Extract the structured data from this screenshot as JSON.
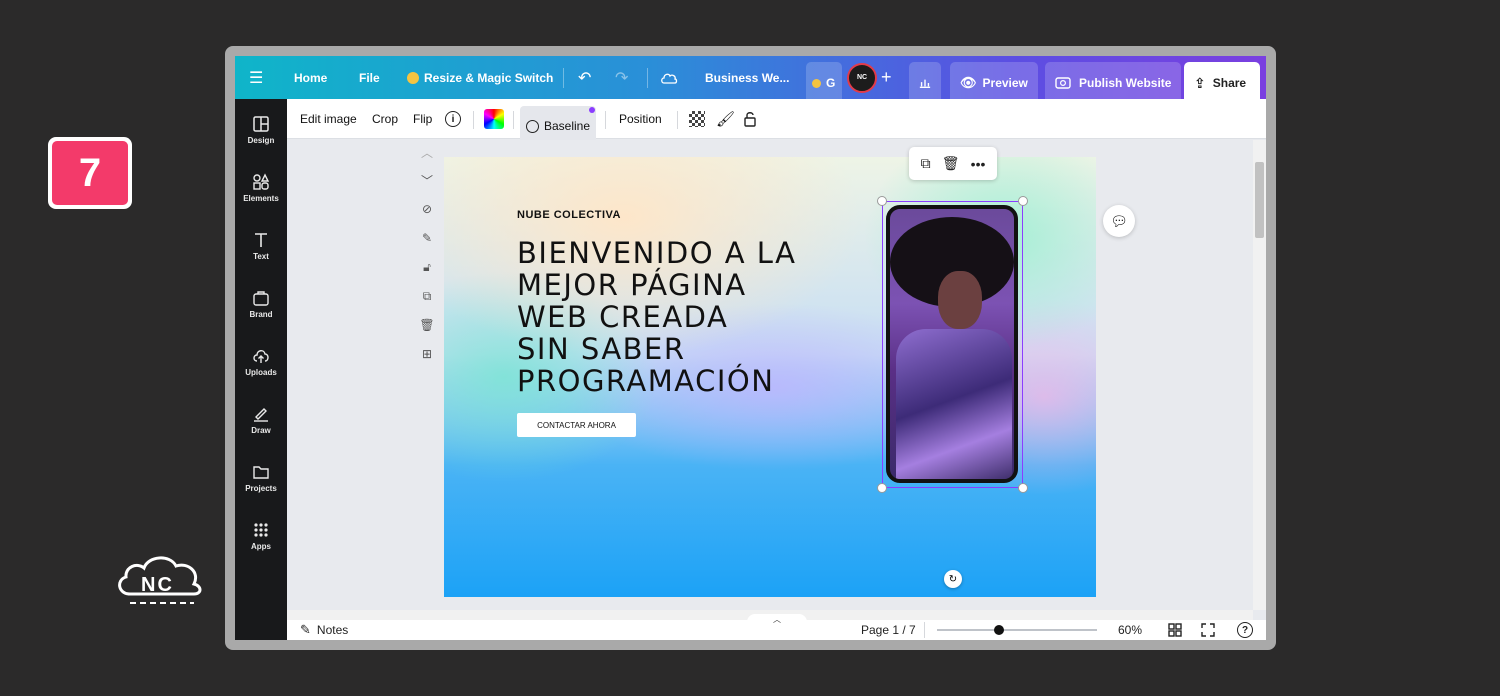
{
  "step_number": "7",
  "logo_text": "NC",
  "topbar": {
    "menu_icon": "hamburger-icon",
    "home": "Home",
    "file": "File",
    "resize": "Resize & Magic Switch",
    "doc_title": "Business We...",
    "team_initial": "G",
    "avatar_text": "NC",
    "preview": "Preview",
    "publish": "Publish Website",
    "share": "Share"
  },
  "sidebar": {
    "items": [
      {
        "label": "Design",
        "icon": "layout-icon"
      },
      {
        "label": "Elements",
        "icon": "shapes-icon"
      },
      {
        "label": "Text",
        "icon": "text-icon"
      },
      {
        "label": "Brand",
        "icon": "brand-icon"
      },
      {
        "label": "Uploads",
        "icon": "cloud-upload-icon"
      },
      {
        "label": "Draw",
        "icon": "pen-icon"
      },
      {
        "label": "Projects",
        "icon": "folder-icon"
      },
      {
        "label": "Apps",
        "icon": "grid-icon"
      }
    ]
  },
  "context_toolbar": {
    "edit_image": "Edit image",
    "crop": "Crop",
    "flip": "Flip",
    "baseline": "Baseline",
    "position": "Position"
  },
  "design": {
    "brand": "NUBE COLECTIVA",
    "headline": [
      "BIENVENIDO A LA",
      "MEJOR PÁGINA",
      "WEB CREADA",
      "SIN SABER",
      "PROGRAMACIÓN"
    ],
    "cta": "CONTACTAR AHORA"
  },
  "bottombar": {
    "notes": "Notes",
    "page": "Page 1 / 7",
    "zoom": "60%",
    "zoom_level": 0.6
  },
  "colors": {
    "step_badge": "#f33a6a",
    "selection": "#8b3dff",
    "sidebar_bg": "#18191b"
  }
}
